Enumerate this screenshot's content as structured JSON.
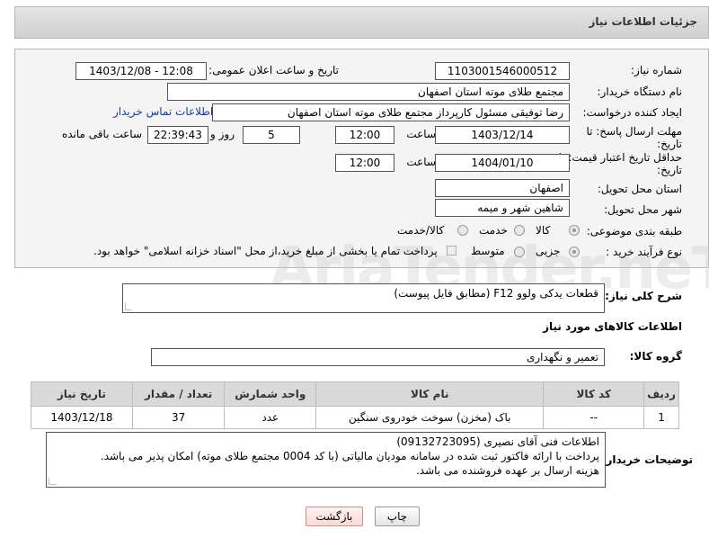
{
  "header": {
    "title": "جزئیات اطلاعات نیاز"
  },
  "watermark": {
    "text": "AriaTender.neT"
  },
  "form": {
    "need_number": {
      "label": "شماره نیاز:",
      "value": "1103001546000512"
    },
    "announce_datetime": {
      "label": "تاریخ و ساعت اعلان عمومی:",
      "value": "1403/12/08 - 12:08"
    },
    "buyer_org": {
      "label": "نام دستگاه خریدار:",
      "value": "مجتمع طلای موته استان اصفهان"
    },
    "requester": {
      "label": "ایجاد کننده درخواست:",
      "value": "رضا توفیقی مسئول کارپرداز مجتمع طلای موته استان اصفهان",
      "contact_link": "اطلاعات تماس خریدار"
    },
    "reply_deadline": {
      "label_line1": "مهلت ارسال پاسخ: تا",
      "label_line2": "تاریخ:",
      "date": "1403/12/14",
      "time_label": "ساعت",
      "time": "12:00",
      "days": "5",
      "days_label": "روز و",
      "remaining": "22:39:43",
      "remaining_label": "ساعت باقی مانده"
    },
    "price_validity": {
      "label_line1": "حداقل تاریخ اعتبار قیمت: تا",
      "label_line2": "تاریخ:",
      "date": "1404/01/10",
      "time_label": "ساعت",
      "time": "12:00"
    },
    "province": {
      "label": "استان محل تحویل:",
      "value": "اصفهان"
    },
    "city": {
      "label": "شهر محل تحویل:",
      "value": "شاهین شهر و میمه"
    },
    "category": {
      "label": "طبقه بندی موضوعی:",
      "options": [
        "کالا",
        "خدمت",
        "کالا/خدمت"
      ],
      "selected": "کالا"
    },
    "process_type": {
      "label": "نوع فرآیند خرید :",
      "options": [
        "جزیی",
        "متوسط"
      ],
      "selected": "جزیی",
      "payment_note": "پرداخت تمام یا بخشی از مبلغ خرید،از محل \"اسناد خزانه اسلامی\" خواهد بود."
    }
  },
  "description": {
    "label": "شرح کلی نیاز:",
    "value": "قطعات یدکی ولوو F12 (مطابق فایل پیوست)"
  },
  "goods_section": {
    "title": "اطلاعات کالاهای مورد نیاز"
  },
  "goods_group": {
    "label": "گروه کالا:",
    "value": "تعمیر و نگهداری"
  },
  "table": {
    "columns": [
      "ردیف",
      "کد کالا",
      "نام کالا",
      "واحد شمارش",
      "تعداد / مقدار",
      "تاریخ نیاز"
    ],
    "rows": [
      [
        "1",
        "--",
        "باک (مخزن) سوخت خودروی سنگین",
        "عدد",
        "37",
        "1403/12/18"
      ]
    ]
  },
  "buyer_notes": {
    "label": "توضیحات خریدار:",
    "lines": [
      "اطلاعات فنی آقای نصیری (09132723095)",
      "پرداخت با ارائه فاکتور ثبت شده در سامانه مودیان مالیاتی (با کد 0004 مجتمع طلای موته) امکان پذیر می باشد.",
      "هزینه ارسال بر عهده فروشنده می باشد."
    ]
  },
  "buttons": {
    "print": "چاپ",
    "back": "بازگشت"
  },
  "colors": {
    "link": "#1a3c8f",
    "header_bg": "#d9d9d9",
    "back_button": "#ffd9d9"
  }
}
